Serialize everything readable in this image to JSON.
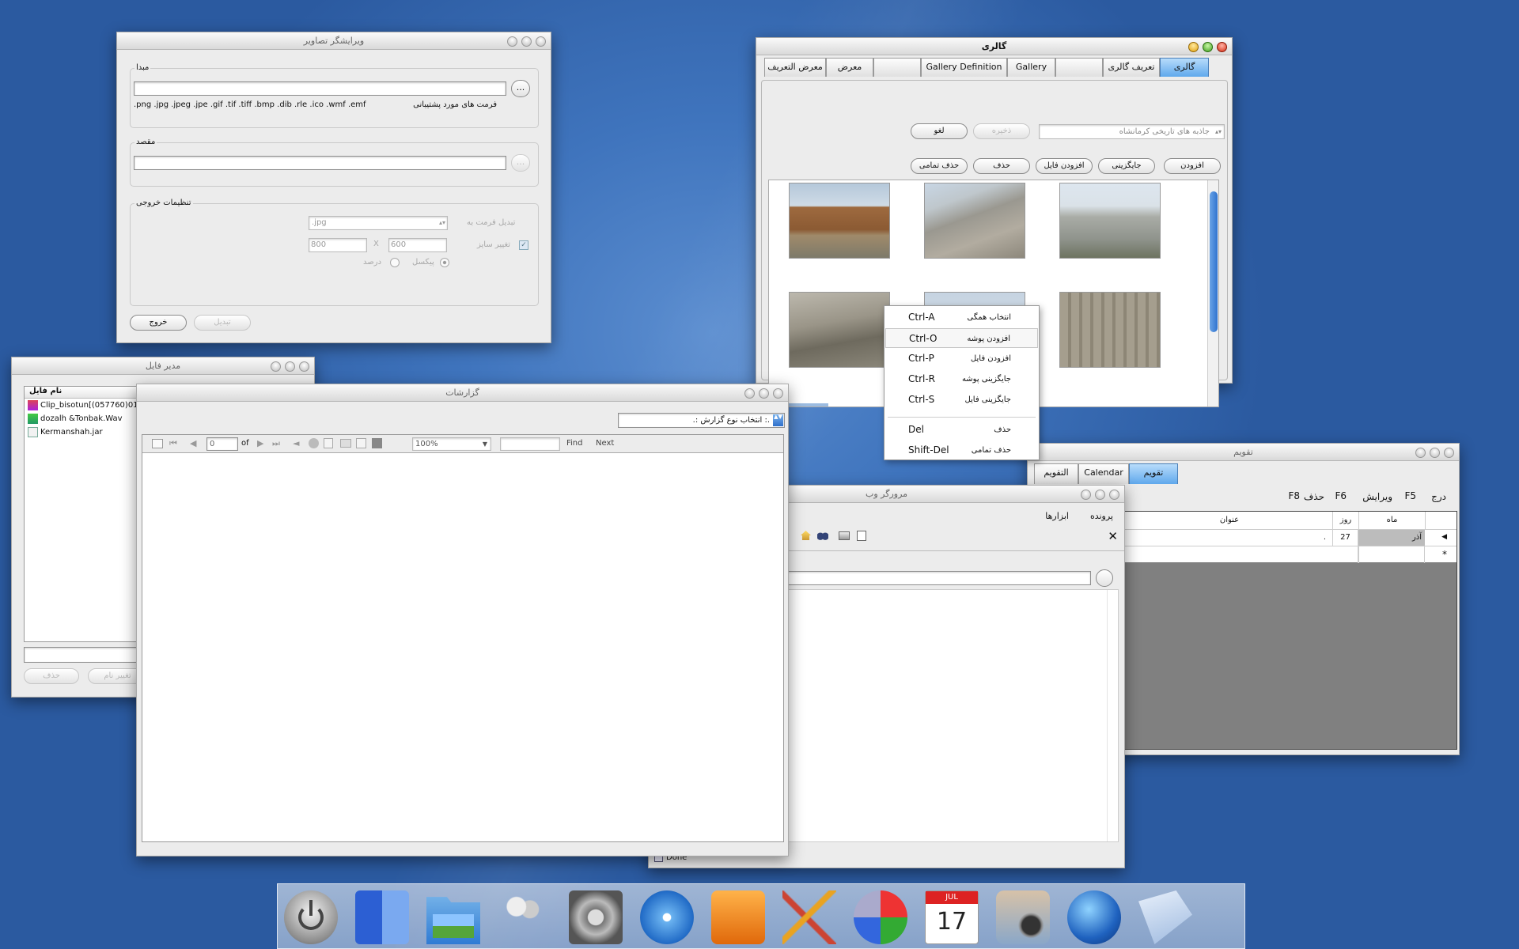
{
  "image_editor": {
    "title": "ویرایشگر تصاویر",
    "source_label": "مبدا",
    "browse": "...",
    "formats_label": "فرمت های مورد پشتیبانی",
    "formats": ".png .jpg .jpeg .jpe .gif .tif .tiff .bmp .dib .rle .ico .wmf .emf",
    "dest_label": "مقصد",
    "output_label": "تنظیمات خروجی",
    "convert_to_label": "تبدیل فرمت به",
    "format_value": ".jpg",
    "resize_label": "تغییر سایز",
    "width": "800",
    "height": "600",
    "x": "X",
    "pixel": "پیکسل",
    "percent": "درصد",
    "exit": "خروج",
    "convert": "تبدیل"
  },
  "file_manager": {
    "title": "مدیر فایل",
    "col": "نام فایل",
    "files": [
      "Clip_bisotun[(057760)01",
      "dozalh &Tonbak.Wav",
      "Kermanshah.jar"
    ],
    "delete": "حذف",
    "rename": "تغییر نام"
  },
  "reports": {
    "title": "گزارشات",
    "select": ".: انتخاب نوع گزارش :.",
    "page": "0",
    "of": "of",
    "zoom": "100%",
    "find": "Find",
    "next": "Next"
  },
  "gallery": {
    "title": "گالری",
    "tabs": [
      "گالری",
      "تعریف گالری",
      "",
      "Gallery",
      "Gallery Definition",
      "",
      "معرض",
      "معرض التعریف"
    ],
    "combo": "جاذبه های تاریخی کرمانشاه",
    "save": "ذخیره",
    "cancel": "لغو",
    "add": "افزودن",
    "replace": "جایگزینی",
    "add_file": "افزودن فایل",
    "delete": "حذف",
    "delete_all": "حذف تمامی"
  },
  "context_menu": {
    "items": [
      {
        "k": "Ctrl-A",
        "t": "انتخاب همگی"
      },
      {
        "k": "Ctrl-O",
        "t": "افزودن پوشه"
      },
      {
        "k": "Ctrl-P",
        "t": "افزودن فایل"
      },
      {
        "k": "Ctrl-R",
        "t": "جایگزینی پوشه"
      },
      {
        "k": "Ctrl-S",
        "t": "جایگزینی فایل"
      },
      {
        "k": "Del",
        "t": "حذف"
      },
      {
        "k": "Shift-Del",
        "t": "حذف تمامی"
      }
    ]
  },
  "calendar": {
    "title": "تقویم",
    "tabs": [
      "تقویم",
      "Calendar",
      "التقویم"
    ],
    "insert": "درج",
    "f5": "F5",
    "edit": "ویرایش",
    "f6": "F6",
    "del": "حذف",
    "f8": "F8",
    "cols": [
      "ماه",
      "روز",
      "عنوان"
    ],
    "row": {
      "month": "آذر",
      "day": "27",
      "title": "."
    },
    "newrow": "*"
  },
  "browser": {
    "title": "مرورگر وب",
    "menu_file": "پرونده",
    "menu_tools": "ابزارها",
    "close": "✕",
    "status": "Done"
  },
  "colors": {
    "accent": "#5fa8ec",
    "desktop": "#3f74bd"
  }
}
